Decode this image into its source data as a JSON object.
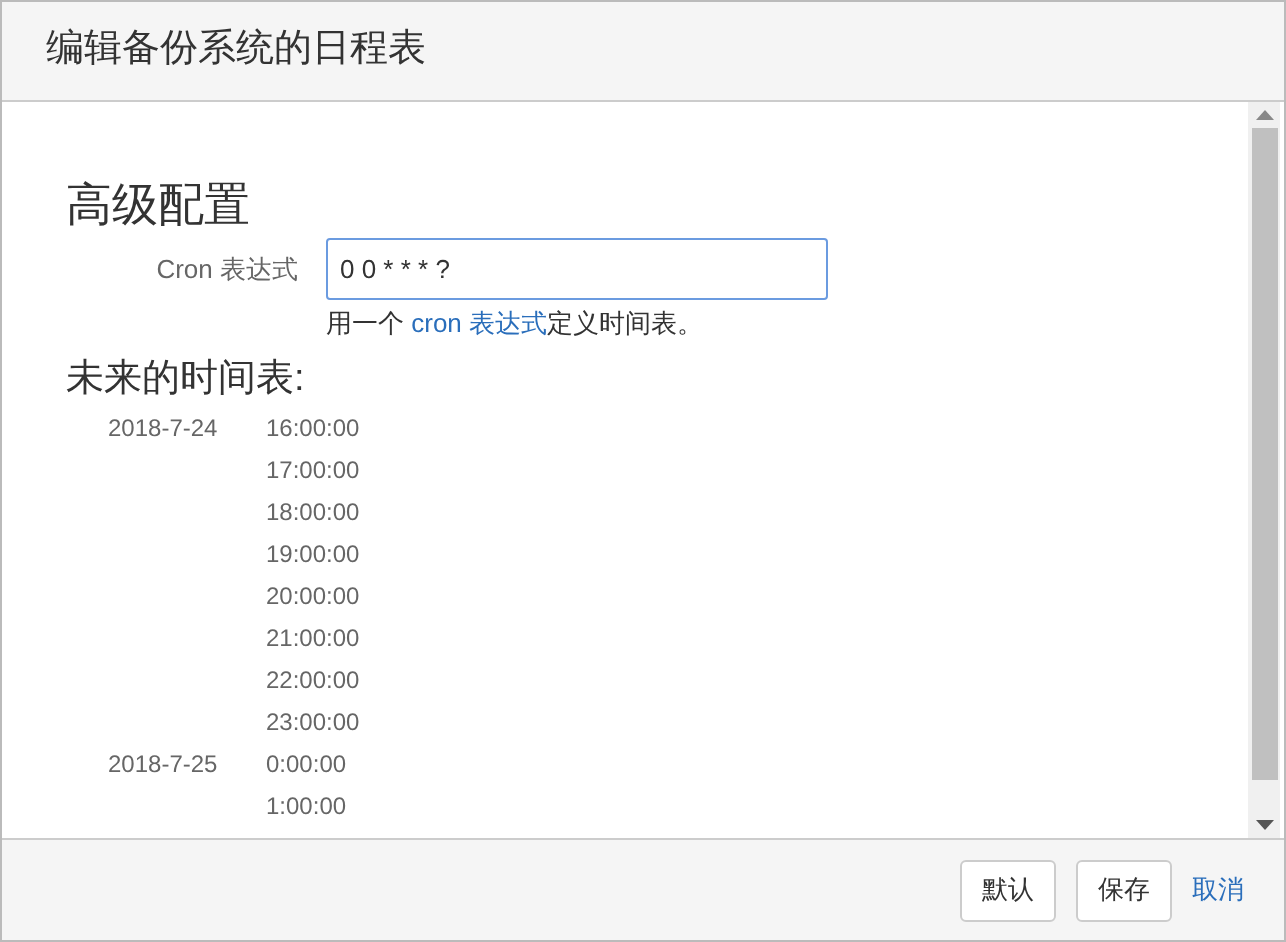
{
  "window": {
    "title": "编辑备份系统的日程表"
  },
  "section_title": "高级配置",
  "cron": {
    "label": "Cron 表达式",
    "value": "0 0 * * * ?",
    "help_prefix": "用一个 ",
    "help_link": "cron 表达式",
    "help_suffix": "定义时间表。"
  },
  "schedule_title": "未来的时间表:",
  "schedule": [
    {
      "date": "2018-7-24",
      "time": "16:00:00"
    },
    {
      "time": "17:00:00"
    },
    {
      "time": "18:00:00"
    },
    {
      "time": "19:00:00"
    },
    {
      "time": "20:00:00"
    },
    {
      "time": "21:00:00"
    },
    {
      "time": "22:00:00"
    },
    {
      "time": "23:00:00"
    },
    {
      "date": "2018-7-25",
      "time": "0:00:00"
    },
    {
      "time": "1:00:00"
    }
  ],
  "buttons": [
    {
      "label": "默认",
      "kind": "button"
    },
    {
      "label": "保存",
      "kind": "button"
    },
    {
      "label": "取消",
      "kind": "link"
    }
  ]
}
